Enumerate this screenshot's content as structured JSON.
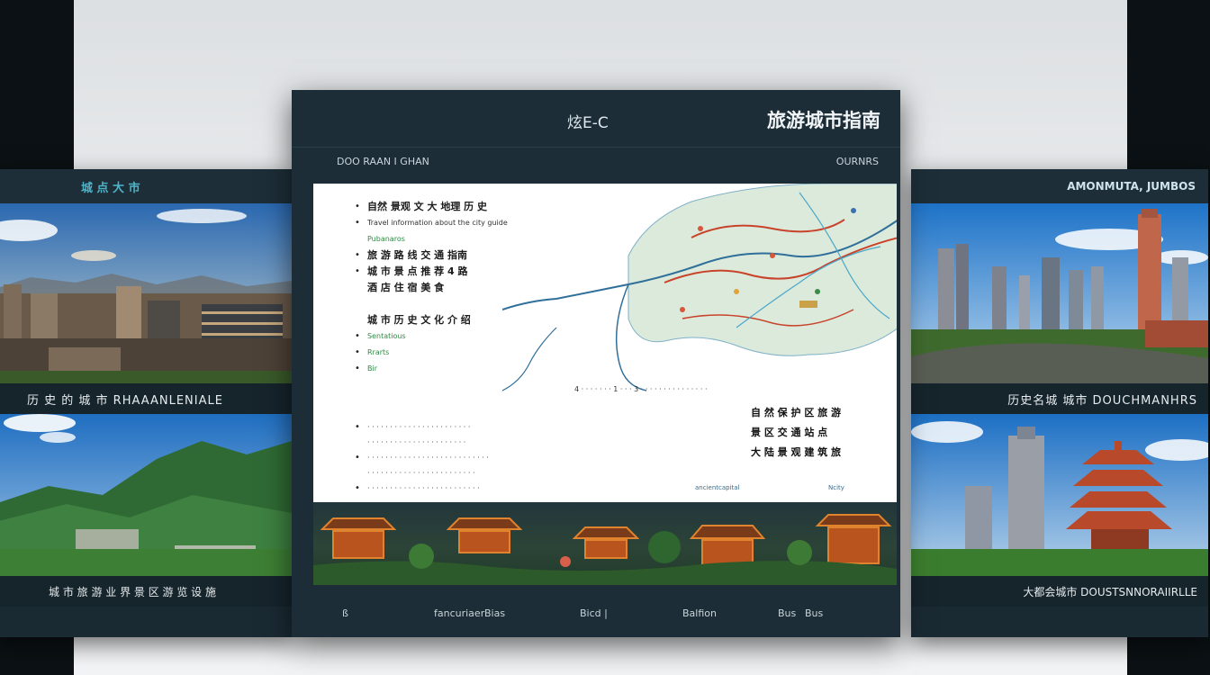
{
  "center": {
    "brand": "炫E-C",
    "title": "旅游城市指南",
    "sub_left": "DOO RAAN I GHAN",
    "sub_right": "OURNRS",
    "doc": {
      "top_items": [
        {
          "type": "bullet",
          "text": "自然 景观 文 大 地理 历 史"
        },
        {
          "type": "small",
          "text": "Travel information about the city guide"
        },
        {
          "type": "green",
          "text": "Pubanaros"
        },
        {
          "type": "bullet",
          "text": "旅 游 路 线 交 通 指南"
        },
        {
          "type": "bullet",
          "text": "城 市 景 点 推 荐 4 路"
        },
        {
          "type": "plain",
          "text": "酒 店 住 宿 美 食"
        },
        {
          "type": "spacer",
          "text": ""
        },
        {
          "type": "plain",
          "text": "城 市 历 史 文 化 介 绍"
        },
        {
          "type": "bullet-green",
          "text": "Sentatious"
        },
        {
          "type": "bullet-green",
          "text": "Rrarts"
        },
        {
          "type": "bullet-green",
          "text": "Bir"
        }
      ],
      "scale_text": "4 · · · · · · · 1 · · · 3 · · · · · · · · · · · · · · ·",
      "lower_items": [
        "· · · · · · · · · · · · · · · · · · · · · · ·",
        "· · · · · · · · · · · · · · · · · · · · · ·",
        "· · · · · · · · · · · · · · · · · · · · · · · · · · ·",
        "· · · · · · · · · · · · · · · · · · · · · · · ·",
        "· · · · · · · · · · · · · · · · · · · · · · · · ·"
      ],
      "right_notes": [
        "自 然 保 护 区 旅 游",
        "景 区 交 通 站 点",
        "大 陆 景 观 建 筑 旅"
      ],
      "map_footer_left": "ancientcapital",
      "map_footer_right": "Ncity"
    },
    "footer": {
      "f1": "ß",
      "f2": "fancuriaer",
      "f3": "Bias",
      "f4": "Bicd  |",
      "f5": "Balfion",
      "f6": "Bus",
      "f7": "Bus"
    }
  },
  "left_panel": {
    "head": "城 点 大 市",
    "caption": "历 史 的 城 市 RHAAANLENIALE",
    "footer": "城 市 旅 游 业 界 景 区 游 览 设 施"
  },
  "right_panel": {
    "head": "AMONMUTA, JUMBOS",
    "caption": "历史名城 城市 DOUCHMANHRS",
    "footer": "大都会城市 DOUSTSNNORAIIRLLE"
  },
  "colors": {
    "panel_bg": "#1c2d37",
    "accent_teal": "#4fb3c7",
    "map_river": "#2f6f99",
    "map_road": "#c9432b"
  }
}
